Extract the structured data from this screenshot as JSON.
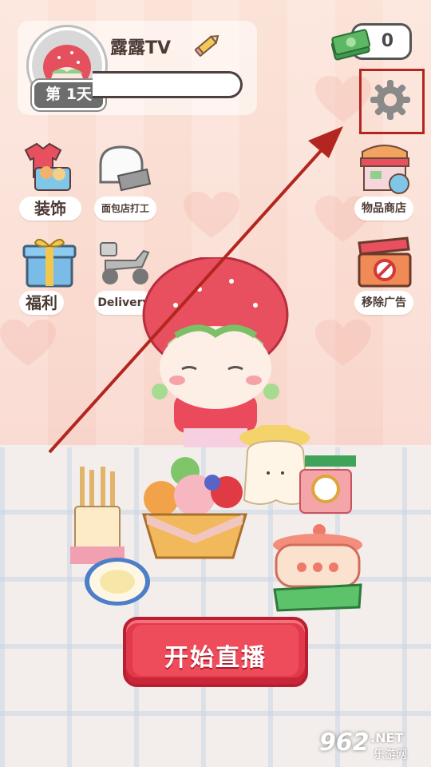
{
  "profile": {
    "username": "露露TV",
    "day_label": "第 1天"
  },
  "currency": {
    "cash_value": "0"
  },
  "menu": {
    "decor_label": "装饰",
    "bakery_job_label": "面包店打工",
    "welfare_label": "福利",
    "delivery_label": "Delivery",
    "item_shop_label": "物品商店",
    "remove_ads_label": "移除广告"
  },
  "actions": {
    "start_stream_label": "开始直播"
  },
  "colors": {
    "accent_red": "#e13a4c",
    "highlight_box": "#b3261f",
    "cash_green": "#4fa85a"
  },
  "watermark": {
    "number": "962",
    "domain": ".NET",
    "site_name": "乐游网"
  }
}
